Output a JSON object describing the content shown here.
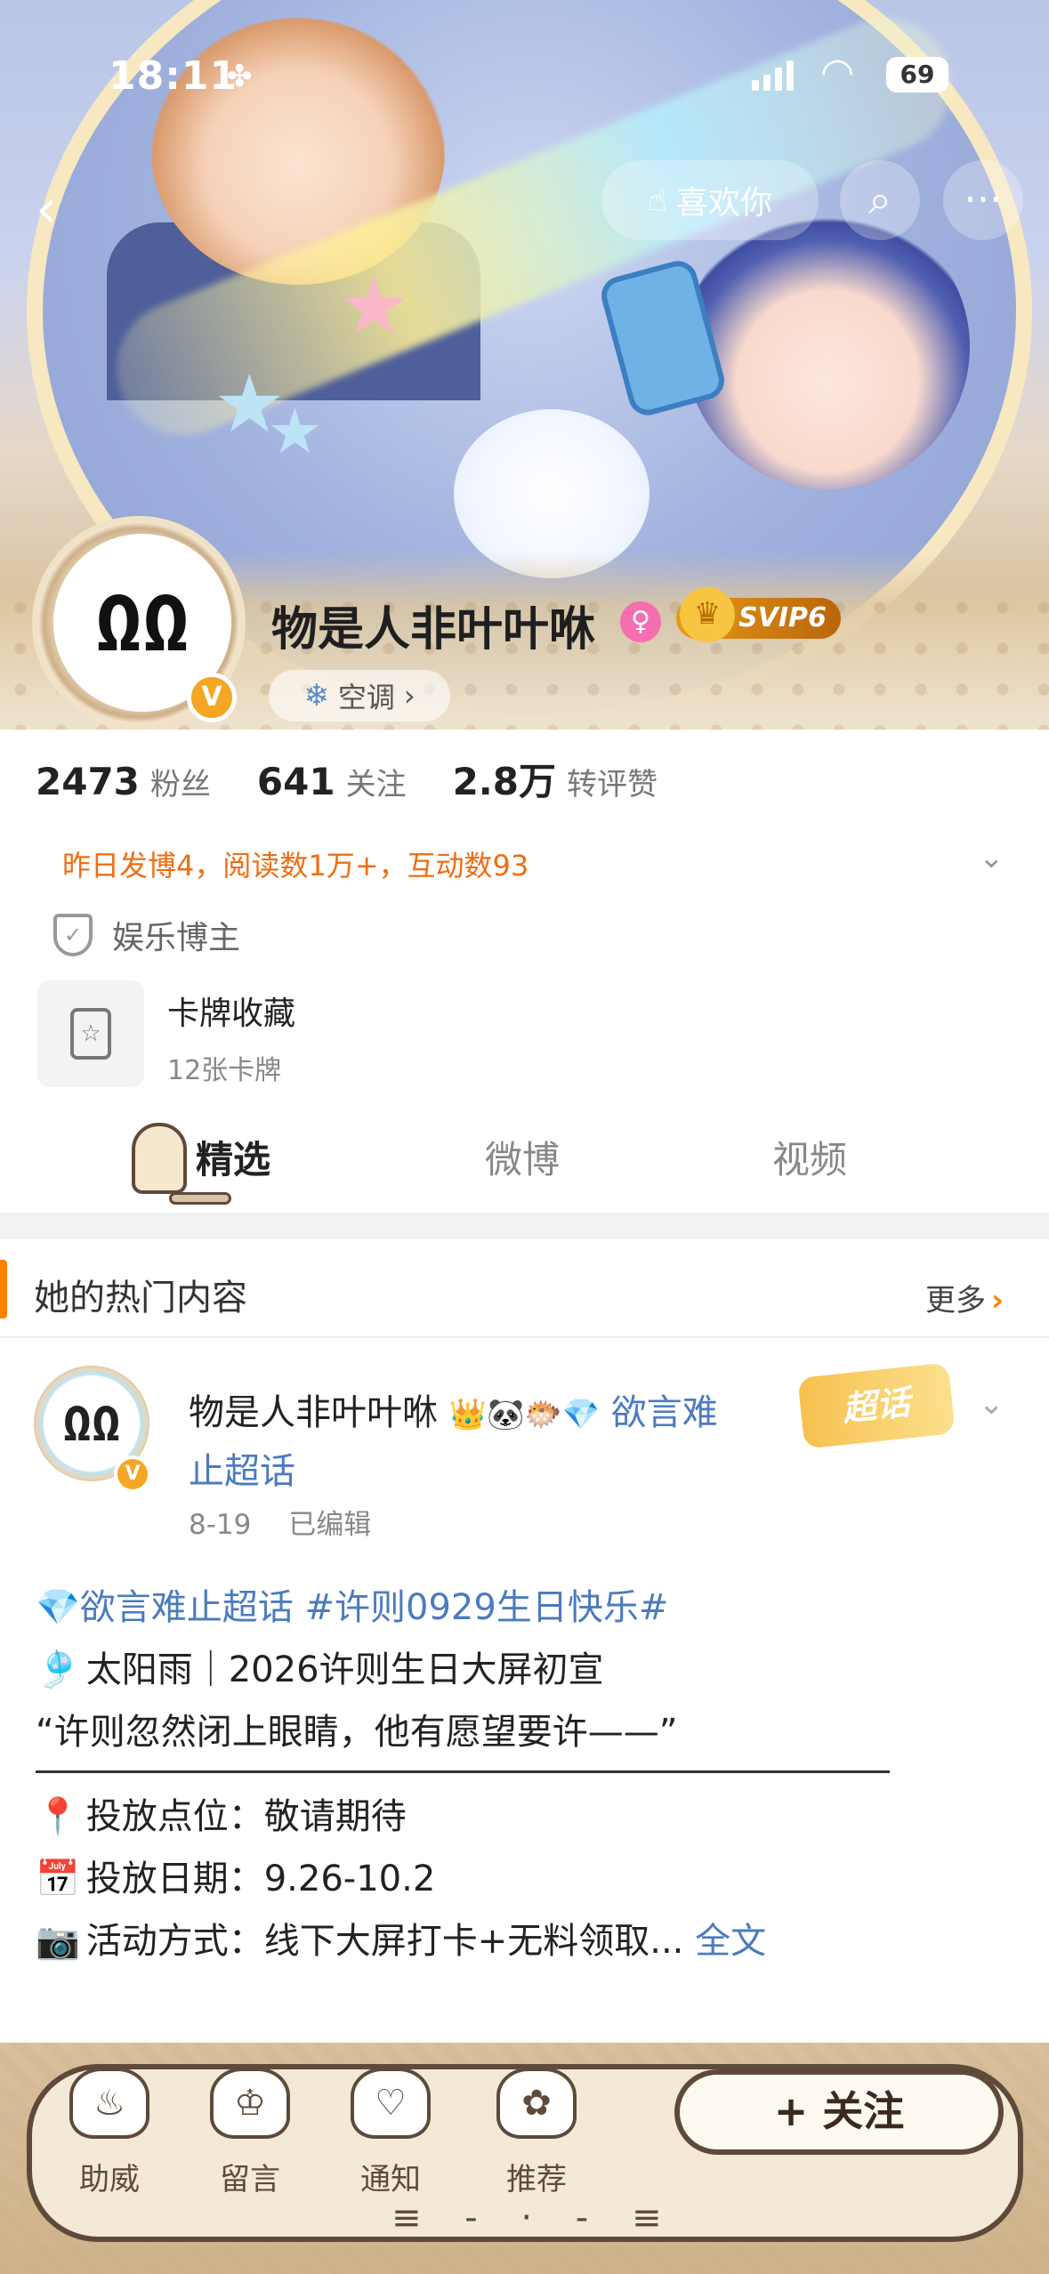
{
  "status_bar": {
    "time": "18:11",
    "battery": "69"
  },
  "header": {
    "like_label": "喜欢你",
    "search_icon": "search-icon",
    "more_icon": "more-icon",
    "back_icon": "back-icon"
  },
  "profile": {
    "username": "物是人非叶叶咻",
    "svip": "SVIP6",
    "tag": "空调",
    "avatar_text": "ΩΩ",
    "stats": [
      {
        "num": "2473",
        "label": "粉丝"
      },
      {
        "num": "641",
        "label": "关注"
      },
      {
        "num": "2.8万",
        "label": "转评赞"
      }
    ],
    "brief": "昨日发博4，阅读数1万+，互动数93",
    "category": "娱乐博主",
    "card": {
      "title": "卡牌收藏",
      "count": "12张卡牌"
    }
  },
  "tabs": [
    {
      "label": "精选",
      "active": true
    },
    {
      "label": "微博",
      "active": false
    },
    {
      "label": "视频",
      "active": false
    }
  ],
  "hot": {
    "title": "她的热门内容",
    "more": "更多"
  },
  "post": {
    "author": "物是人非叶叶咻",
    "author_badges": "👑🐼🐡💎",
    "author_topic": "欲言难止超话",
    "date": "8-19",
    "edited": "已编辑",
    "supertopic_badge": "超话",
    "line1_link": "💎欲言难止超话 #许则0929生日快乐#",
    "line2_emoji": "🎐",
    "line2": "太阳雨｜2026许则生日大屏初宣",
    "line3": "“许则忽然闭上眼睛，他有愿望要许——”",
    "line4_emoji": "📍",
    "line4": "投放点位：敬请期待",
    "line5_emoji": "📅",
    "line5": "投放日期：9.26-10.2",
    "line6_emoji": "📷",
    "line6": "活动方式：线下大屏打卡+无料领取...",
    "full_text": "全文"
  },
  "bottom_bar": {
    "items": [
      "助威",
      "留言",
      "通知",
      "推荐"
    ],
    "follow": "+ 关注"
  }
}
